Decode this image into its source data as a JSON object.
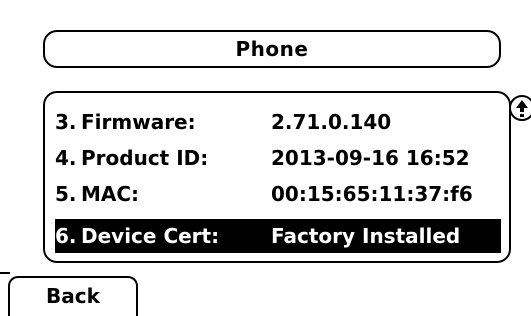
{
  "header": {
    "title": "Phone"
  },
  "status_list": {
    "items": [
      {
        "number": "3.",
        "label": "Firmware:",
        "value": "2.71.0.140",
        "selected": false
      },
      {
        "number": "4.",
        "label": "Product ID:",
        "value": "2013-09-16 16:52",
        "selected": false
      },
      {
        "number": "5.",
        "label": "MAC:",
        "value": "00:15:65:11:37:f6",
        "selected": false
      },
      {
        "number": "6.",
        "label": "Device Cert:",
        "value": "Factory Installed",
        "selected": true
      }
    ]
  },
  "scroll": {
    "icon": "scroll-up-icon"
  },
  "softkeys": {
    "back_label": "Back"
  },
  "colors": {
    "background": "#ffffff",
    "foreground": "#000000",
    "selected_background": "#000000",
    "selected_text": "#ffffff"
  }
}
